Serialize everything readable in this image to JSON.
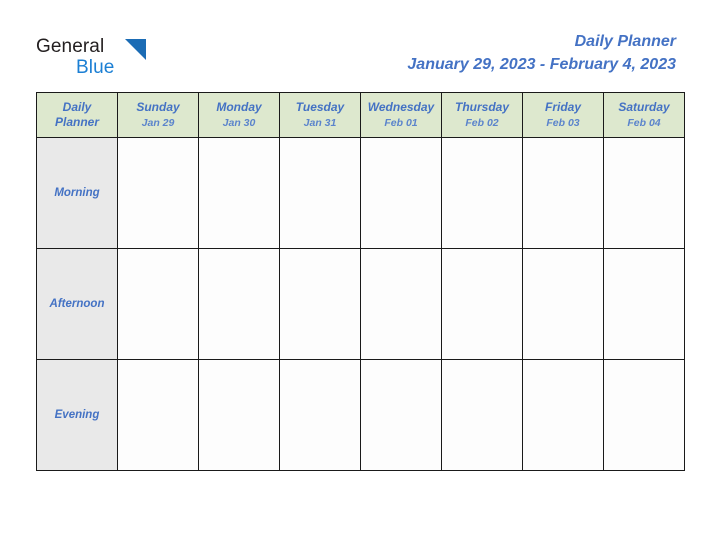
{
  "brand": {
    "name_part1": "General",
    "name_part2": "Blue",
    "triangle_icon": "triangle-icon",
    "colors": {
      "dark": "#231f20",
      "blue": "#1b7fd4",
      "triangle": "#1b6cb5"
    }
  },
  "header": {
    "title": "Daily Planner",
    "date_range": "January 29, 2023 - February 4, 2023",
    "accent_color": "#4472c4"
  },
  "table": {
    "corner": {
      "line1": "Daily",
      "line2": "Planner"
    },
    "header_background": "#dde8ce",
    "label_background": "#e9e9e9",
    "border_color": "#1a1a1a",
    "days": [
      {
        "name": "Sunday",
        "date": "Jan 29"
      },
      {
        "name": "Monday",
        "date": "Jan 30"
      },
      {
        "name": "Tuesday",
        "date": "Jan 31"
      },
      {
        "name": "Wednesday",
        "date": "Feb 01"
      },
      {
        "name": "Thursday",
        "date": "Feb 02"
      },
      {
        "name": "Friday",
        "date": "Feb 03"
      },
      {
        "name": "Saturday",
        "date": "Feb 04"
      }
    ],
    "slots": [
      {
        "label": "Morning",
        "entries": [
          "",
          "",
          "",
          "",
          "",
          "",
          ""
        ]
      },
      {
        "label": "Afternoon",
        "entries": [
          "",
          "",
          "",
          "",
          "",
          "",
          ""
        ]
      },
      {
        "label": "Evening",
        "entries": [
          "",
          "",
          "",
          "",
          "",
          "",
          ""
        ]
      }
    ]
  }
}
